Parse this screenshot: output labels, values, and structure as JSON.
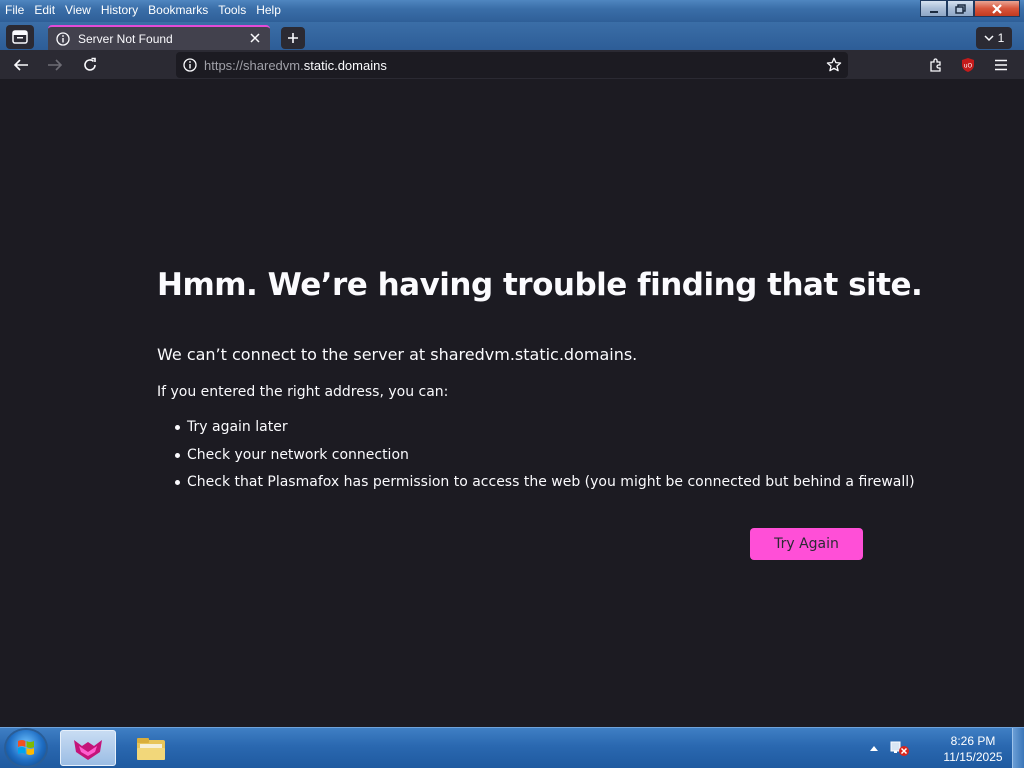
{
  "menu": {
    "file": "File",
    "edit": "Edit",
    "view": "View",
    "history": "History",
    "bookmarks": "Bookmarks",
    "tools": "Tools",
    "help": "Help"
  },
  "tabs": {
    "active_title": "Server Not Found",
    "count": "1"
  },
  "urlbar": {
    "scheme": "https://",
    "sub": "sharedvm.",
    "domain": "static.domains"
  },
  "error": {
    "title": "Hmm. We’re having trouble finding that site.",
    "description": "We can’t connect to the server at sharedvm.static.domains.",
    "lead": "If you entered the right address, you can:",
    "suggestions": [
      "Try again later",
      "Check your network connection",
      "Check that Plasmafox has permission to access the web (you might be connected but behind a firewall)"
    ],
    "button": "Try Again"
  },
  "taskbar": {
    "time": "8:26 PM",
    "date": "11/15/2025"
  },
  "colors": {
    "accent": "#ff4fd7",
    "page_bg": "#1c1b22",
    "toolbar_bg": "#2b2a33",
    "tab_bg": "#42414d"
  }
}
